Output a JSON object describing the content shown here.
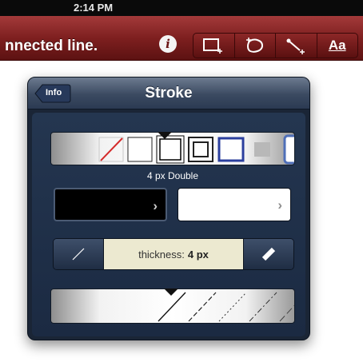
{
  "status_bar": {
    "time": "2:14 PM"
  },
  "toolbar": {
    "message": "nnected line.",
    "info_icon": "info-icon",
    "text_tool_label": "Aa",
    "tools": [
      "rectangle-tool-icon",
      "shape-tool-icon",
      "line-tool-icon",
      "text-tool"
    ]
  },
  "popover": {
    "back_label": "Info",
    "title": "Stroke",
    "stroke_style_label": "4 px Double",
    "stroke_color": "#000000",
    "fill_color": "#ffffff",
    "thickness_label": "thickness:",
    "thickness_value": "4 px"
  },
  "colors": {
    "toolbar": "#7e1f1f",
    "popover": "#1a2536",
    "thickness_bg": "#ece9d0",
    "selected_style_border": "#2b3f9e"
  }
}
